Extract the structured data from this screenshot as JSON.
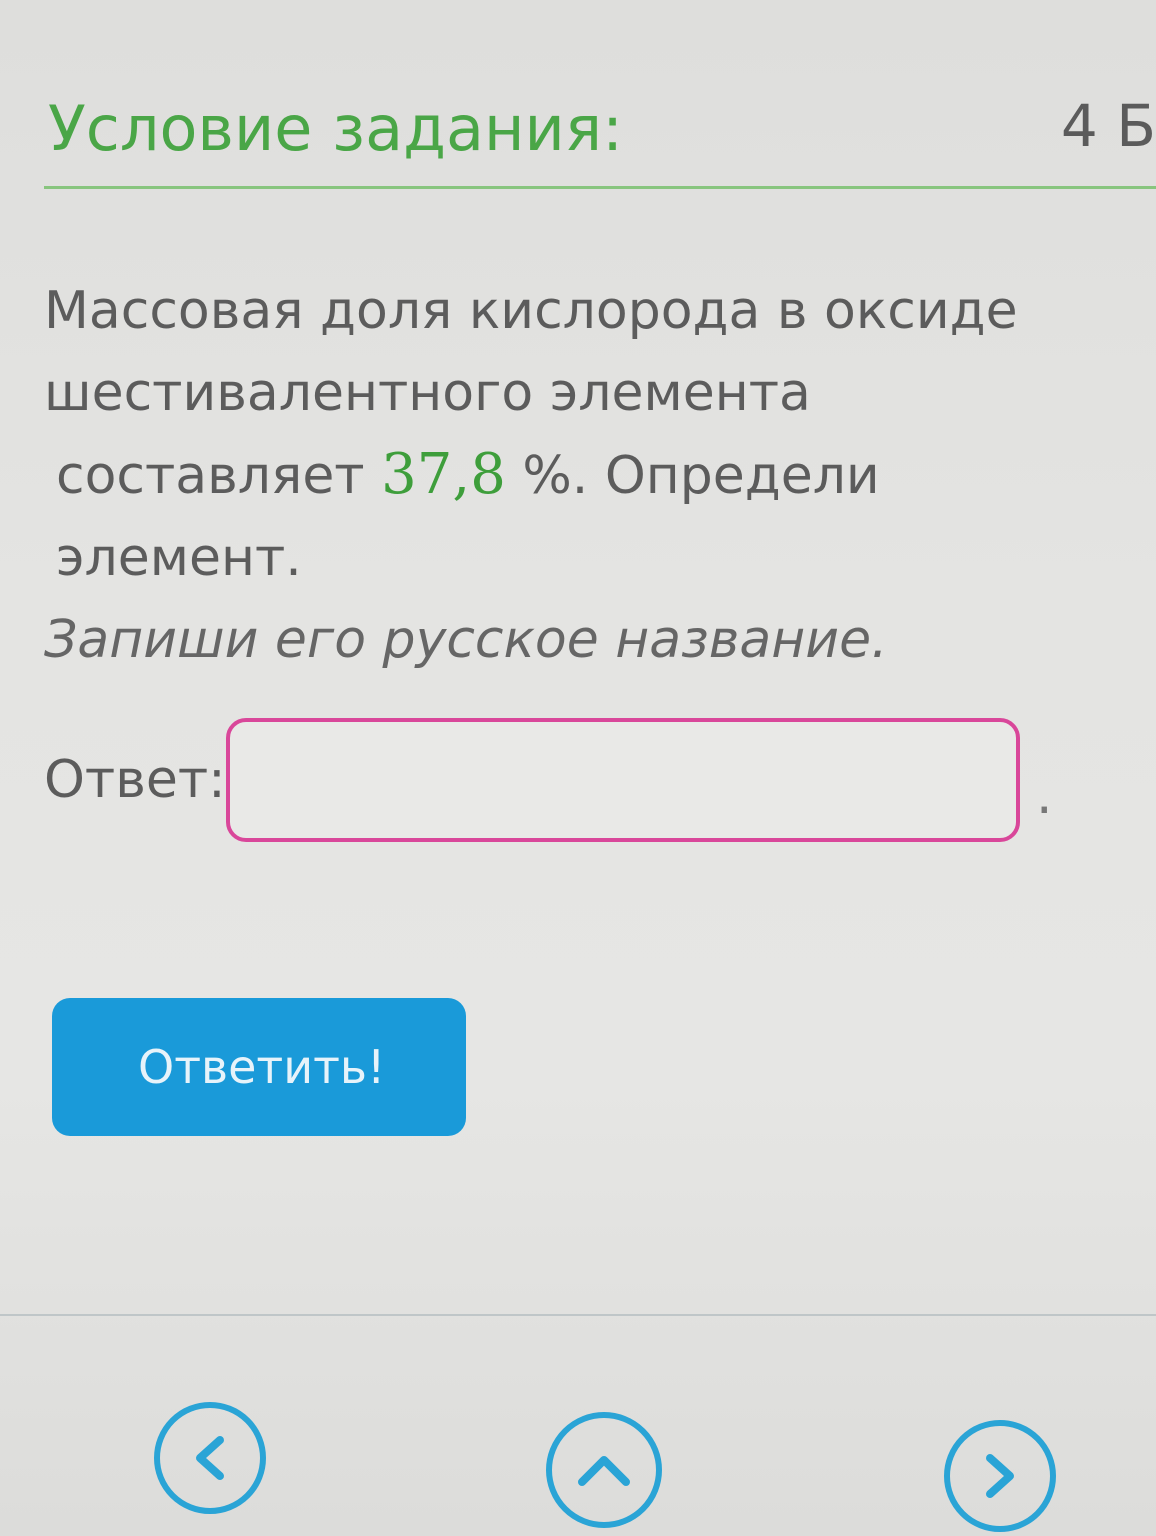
{
  "header": {
    "title": "Условие задания:",
    "points": "4 Б"
  },
  "task": {
    "line1": "Массовая доля кислорода в оксиде",
    "line2": "шестивалентного элемента",
    "line3_prefix": "составляет ",
    "value": "37,8",
    "line3_suffix": " %. Определи элемент.",
    "hint": "Запиши его русское название."
  },
  "answer": {
    "label": "Ответ:",
    "value": "",
    "dot": "."
  },
  "submit_label": "Ответить!",
  "navigation": {
    "prev_icon": "chevron-left-icon",
    "up_icon": "chevron-up-icon",
    "next_icon": "chevron-right-icon"
  },
  "colors": {
    "title_green": "#4aa647",
    "input_border": "#d9479a",
    "button_blue": "#1a9ad9",
    "nav_blue": "#2aa4d6"
  }
}
